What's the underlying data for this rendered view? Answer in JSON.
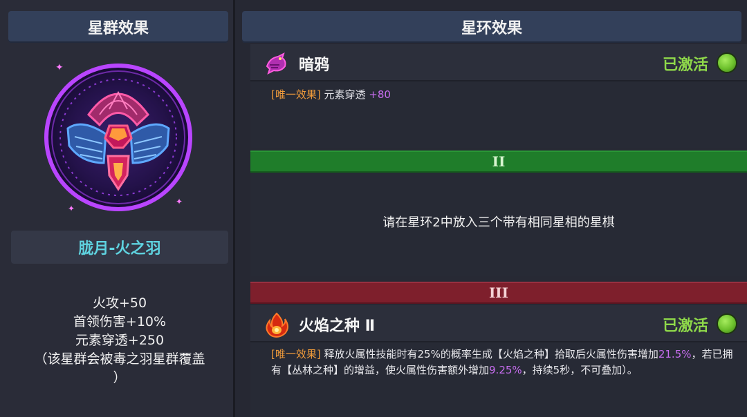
{
  "left": {
    "header": "星群效果",
    "constellation_name": "胧月-火之羽",
    "stats": [
      "火攻+50",
      "首领伤害+10%",
      "元素穿透+250",
      "（该星群会被毒之羽星群覆盖",
      "）"
    ]
  },
  "right": {
    "header": "星环效果",
    "slot1": {
      "title": "暗鸦",
      "status": "已激活",
      "icon": "crow-icon",
      "effect_tag": "[唯一效果]",
      "effect_text": "元素穿透",
      "effect_value": "+80"
    },
    "tier2": {
      "label": "II",
      "hint": "请在星环2中放入三个带有相同星相的星棋"
    },
    "tier3": {
      "label": "III"
    },
    "slot3": {
      "title": "火焰之种 Ⅱ",
      "status": "已激活",
      "icon": "flame-seed-icon",
      "effect_tag": "[唯一效果]",
      "effect_part1": "释放火属性技能时有25%的概率生成【火焰之种】拾取后火属性伤害增加",
      "effect_value1": "21.5%",
      "effect_part2": "，若已拥有【丛林之种】的增益，使火属性伤害额外增加",
      "effect_value2": "9.25%",
      "effect_part3": "，持续5秒，不可叠加）。"
    }
  },
  "colors": {
    "active_green": "#8fd94a",
    "tag_orange": "#ee9a3a",
    "value_purple": "#c86ef0",
    "name_cyan": "#5fd3e0",
    "tier2_bar": "#1f7d2a",
    "tier3_bar": "#7e1f2c"
  }
}
